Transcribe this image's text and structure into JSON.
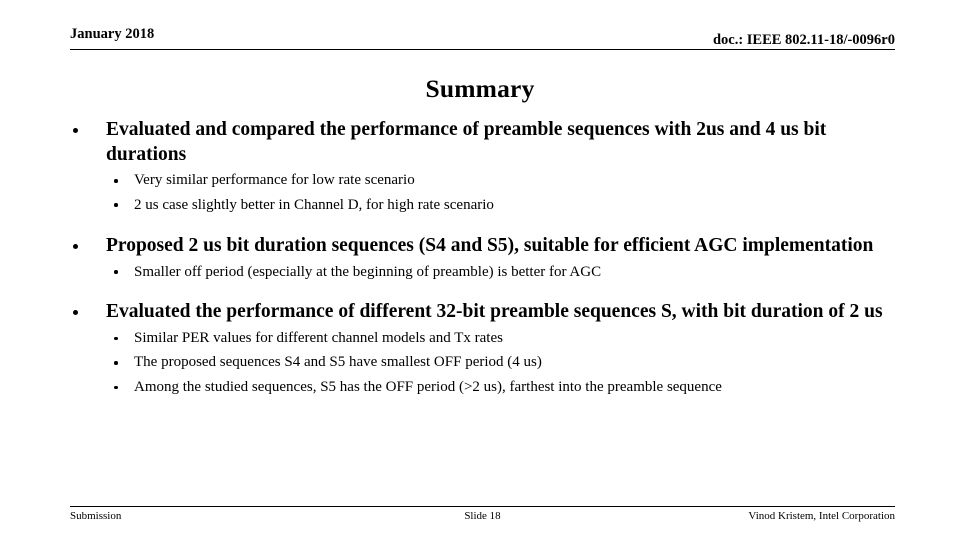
{
  "header": {
    "date": "January 2018",
    "doc": "doc.: IEEE 802.11-18/-0096r0"
  },
  "title": "Summary",
  "content": {
    "bullets": [
      {
        "text": "Evaluated and compared the performance of preamble sequences with 2us and 4 us bit durations",
        "sub": [
          "Very similar performance for low rate scenario",
          "2 us case slightly better in Channel D, for high rate scenario"
        ]
      },
      {
        "text": "Proposed 2 us bit duration sequences (S4 and S5), suitable for efficient AGC implementation",
        "sub": [
          "Smaller off period (especially at the beginning of preamble) is better for AGC"
        ]
      },
      {
        "text": "Evaluated the performance of different 32-bit preamble sequences S, with bit duration of 2 us",
        "sub": [
          "Similar PER values for different channel models and Tx rates",
          "The proposed sequences S4 and S5 have smallest OFF period (4 us)",
          "Among the studied sequences, S5 has the OFF period (>2 us), farthest into the preamble sequence"
        ]
      }
    ]
  },
  "footer": {
    "left": "Submission",
    "center": "Slide 18",
    "right": "Vinod Kristem, Intel Corporation"
  }
}
